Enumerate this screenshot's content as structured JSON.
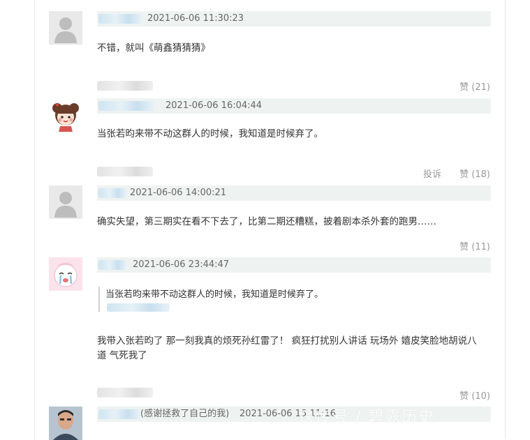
{
  "comments": [
    {
      "time": "2021-06-06 11:30:23",
      "text": "不错，就叫《萌鑫猜猜猜》",
      "likes": "赞 (21)"
    },
    {
      "time": "2021-06-06 16:04:44",
      "text": "当张若昀来带不动这群人的时候，我知道是时候弃了。",
      "report": "投诉",
      "likes": "赞 (18)"
    },
    {
      "time": "2021-06-06 14:00:21",
      "text": "确实失望，第三期实在看不下去了，比第二期还糟糕，披着剧本杀外套的跑男……",
      "likes": "赞 (11)"
    },
    {
      "time": "2021-06-06 23:44:47",
      "quote": "当张若昀来带不动这群人的时候，我知道是时候弃了。",
      "text_line1": "我带入张若昀了 那一刻我真的烦死孙红雷了！ 疯狂打扰别人讲话 玩场外 嬉皮笑脸地胡说八",
      "text_line2": "道 气死我了",
      "likes": "赞 (10)"
    },
    {
      "nick_suffix": "(感谢拯救了自己的我)",
      "time": "2021-06-06 15:11:16"
    }
  ],
  "watermark": "快传号 / 碧露历史",
  "icons": {
    "default_avatar": "user-silhouette-icon",
    "girl_avatar": "cartoon-girl-avatar",
    "crying_avatar": "crying-cartoon-avatar",
    "photo_avatar": "man-photo-avatar"
  }
}
